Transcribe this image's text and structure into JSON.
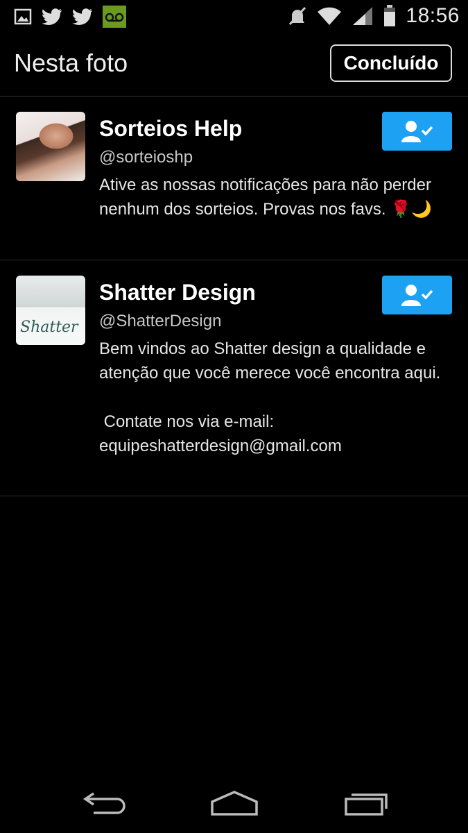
{
  "status_bar": {
    "time": "18:56",
    "left_icons": [
      "gallery-icon",
      "twitter-icon",
      "twitter-icon",
      "voicemail-icon"
    ],
    "right_icons": [
      "mute-icon",
      "wifi-icon",
      "signal-icon",
      "battery-icon"
    ],
    "voicemail_color": "#6a9a1f"
  },
  "header": {
    "title": "Nesta foto",
    "done_label": "Concluído"
  },
  "users": [
    {
      "name": "Sorteios Help",
      "handle": "@sorteioshp",
      "bio": "Ative as nossas notificações para não perder nenhum dos sorteios. Provas nos favs. 🌹🌙",
      "following": true
    },
    {
      "name": "Shatter Design",
      "handle": "@ShatterDesign",
      "bio": "Bem vindos ao Shatter design a qualidade e atenção que você merece você encontra aqui.\n\n Contate nos via e-mail: equipeshatterdesign@gmail.com",
      "avatar_text": "Shatter",
      "following": true
    }
  ],
  "nav": {
    "icons": [
      "back-icon",
      "home-icon",
      "recents-icon"
    ]
  },
  "colors": {
    "accent": "#1da1f2",
    "background": "#000000",
    "divider": "#2e2e2e"
  }
}
